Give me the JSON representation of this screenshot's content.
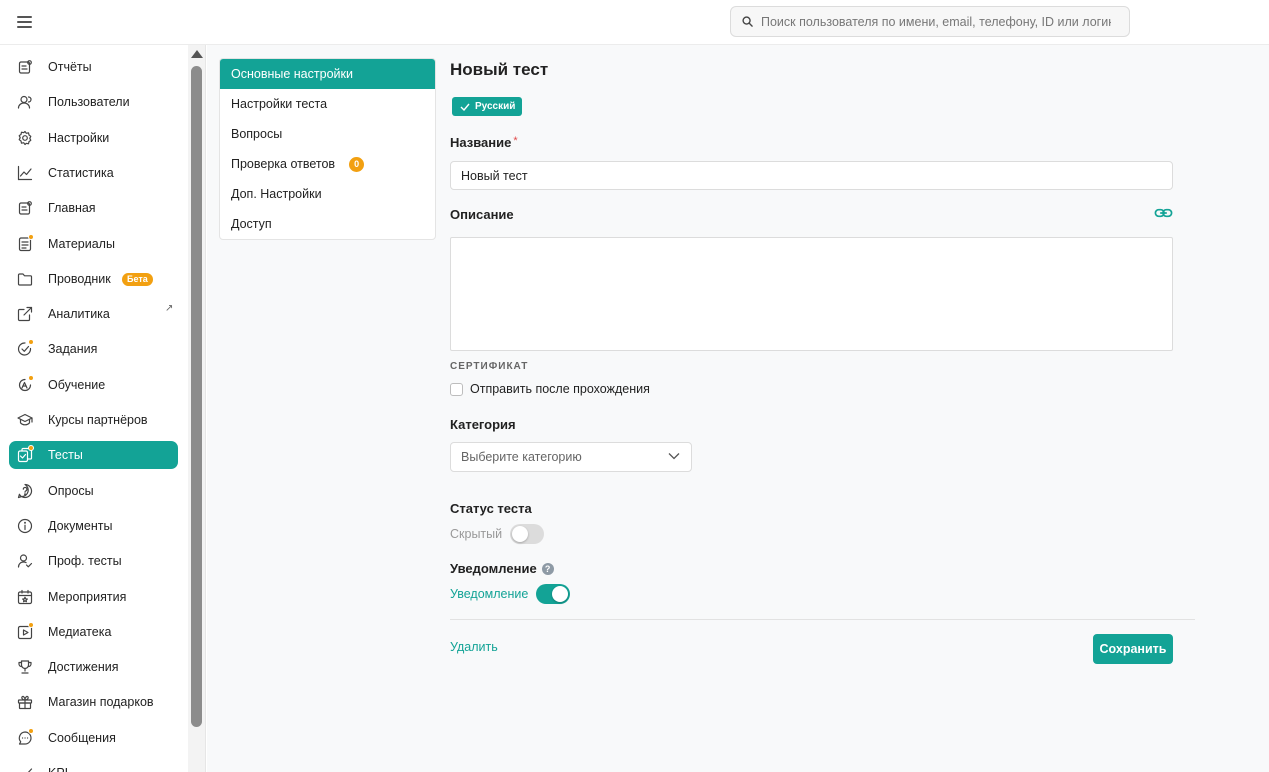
{
  "header": {
    "search_placeholder": "Поиск пользователя по имени, email, телефону, ID или логину"
  },
  "sidebar": {
    "items": [
      {
        "label": "Отчёты",
        "icon": "report-icon"
      },
      {
        "label": "Пользователи",
        "icon": "users-icon"
      },
      {
        "label": "Настройки",
        "icon": "gear-icon"
      },
      {
        "label": "Статистика",
        "icon": "chart-line-icon"
      },
      {
        "label": "Главная",
        "icon": "home-icon"
      },
      {
        "label": "Материалы",
        "icon": "materials-icon",
        "dot": true
      },
      {
        "label": "Проводник",
        "icon": "folder-icon",
        "badge": "Бета"
      },
      {
        "label": "Аналитика",
        "icon": "external-link-icon",
        "external": "↗"
      },
      {
        "label": "Задания",
        "icon": "task-check-icon",
        "dot": true
      },
      {
        "label": "Обучение",
        "icon": "learning-icon",
        "dot": true
      },
      {
        "label": "Курсы партнёров",
        "icon": "graduation-cap-icon"
      },
      {
        "label": "Тесты",
        "icon": "tests-icon",
        "dot": true,
        "active": true
      },
      {
        "label": "Опросы",
        "icon": "survey-icon"
      },
      {
        "label": "Документы",
        "icon": "info-icon"
      },
      {
        "label": "Проф. тесты",
        "icon": "user-check-icon"
      },
      {
        "label": "Мероприятия",
        "icon": "calendar-icon"
      },
      {
        "label": "Медиатека",
        "icon": "media-icon",
        "dot": true
      },
      {
        "label": "Достижения",
        "icon": "trophy-icon"
      },
      {
        "label": "Магазин подарков",
        "icon": "gift-icon"
      },
      {
        "label": "Сообщения",
        "icon": "chat-icon",
        "dot": true
      },
      {
        "label": "KPI",
        "icon": "kpi-icon"
      }
    ]
  },
  "tabs": [
    {
      "label": "Основные настройки",
      "active": true
    },
    {
      "label": "Настройки теста"
    },
    {
      "label": "Вопросы"
    },
    {
      "label": "Проверка ответов",
      "badge": "0"
    },
    {
      "label": "Доп. Настройки"
    },
    {
      "label": "Доступ"
    }
  ],
  "form": {
    "title": "Новый тест",
    "language_tag": "Русский",
    "name_label": "Название",
    "required_mark": "*",
    "name_value": "Новый тест",
    "description_label": "Описание",
    "certificate_caption": "СЕРТИФИКАТ",
    "certificate_checkbox_label": "Отправить после прохождения",
    "category_label": "Категория",
    "category_placeholder": "Выберите категорию",
    "status_label": "Статус теста",
    "status_toggle_label": "Скрытый",
    "status_toggle_on": false,
    "notification_label": "Уведомление",
    "notification_help": "?",
    "notification_toggle_label": "Уведомление",
    "notification_toggle_on": true,
    "delete_label": "Удалить",
    "save_label": "Сохранить"
  },
  "colors": {
    "accent": "#13a396",
    "badge": "#f2a011",
    "required": "#e04848"
  }
}
